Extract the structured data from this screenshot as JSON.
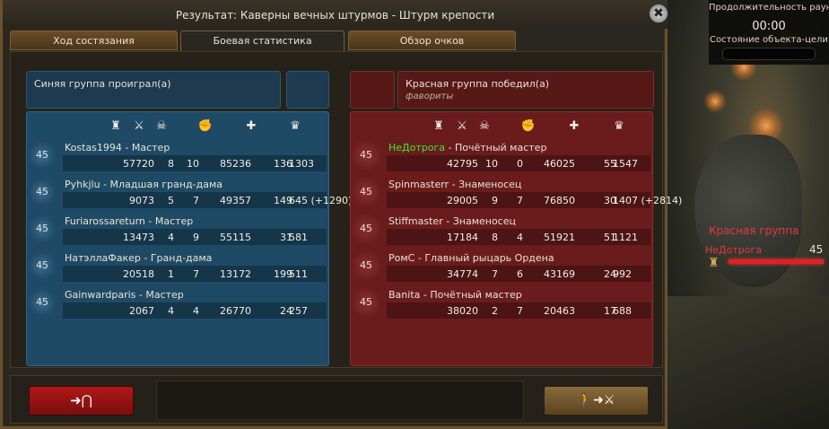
{
  "window": {
    "title": "Результат: Каверны вечных штурмов - Штурм крепости",
    "close_label": "✖"
  },
  "tabs": [
    {
      "label": "Ход состязания"
    },
    {
      "label": "Боевая статистика"
    },
    {
      "label": "Обзор очков"
    }
  ],
  "blue": {
    "result": "Синяя группа проиграл(а)",
    "players": [
      {
        "level": "45",
        "name": "Kostas1994",
        "rank": "Мастер",
        "s1": "57720",
        "s2": "8",
        "s3": "10",
        "s4": "85236",
        "s5": "136",
        "s6": "1303"
      },
      {
        "level": "45",
        "name": "Pyhkjlu",
        "rank": "Младшая гранд-дама",
        "s1": "9073",
        "s2": "5",
        "s3": "7",
        "s4": "49357",
        "s5": "149",
        "s6": "645 (+1290)"
      },
      {
        "level": "45",
        "name": "Furiarossareturn",
        "rank": "Мастер",
        "s1": "13473",
        "s2": "4",
        "s3": "9",
        "s4": "55115",
        "s5": "31",
        "s6": "581"
      },
      {
        "level": "45",
        "name": "НатэллаФакер",
        "rank": "Гранд-дама",
        "s1": "20518",
        "s2": "1",
        "s3": "7",
        "s4": "13172",
        "s5": "199",
        "s6": "511"
      },
      {
        "level": "45",
        "name": "Gainwardparis",
        "rank": "Мастер",
        "s1": "2067",
        "s2": "4",
        "s3": "4",
        "s4": "26770",
        "s5": "24",
        "s6": "257"
      }
    ]
  },
  "red": {
    "result": "Красная группа победил(а)",
    "subtitle": "фавориты",
    "players": [
      {
        "level": "45",
        "name": "НеДотрога",
        "rank": "Почётный мастер",
        "s1": "42795",
        "s2": "10",
        "s3": "0",
        "s4": "46025",
        "s5": "55",
        "s6": "1547",
        "self": true
      },
      {
        "level": "45",
        "name": "Spinmasterr",
        "rank": "Знаменосец",
        "s1": "29005",
        "s2": "9",
        "s3": "7",
        "s4": "76850",
        "s5": "30",
        "s6": "1407 (+2814)"
      },
      {
        "level": "45",
        "name": "Stiffmaster",
        "rank": "Знаменосец",
        "s1": "17184",
        "s2": "8",
        "s3": "4",
        "s4": "51921",
        "s5": "51",
        "s6": "1121"
      },
      {
        "level": "45",
        "name": "PомС",
        "rank": "Главный рыцарь Ордена",
        "s1": "34774",
        "s2": "7",
        "s3": "6",
        "s4": "43169",
        "s5": "24",
        "s6": "992"
      },
      {
        "level": "45",
        "name": "Banita",
        "rank": "Почётный мастер",
        "s1": "38020",
        "s2": "2",
        "s3": "7",
        "s4": "20463",
        "s5": "17",
        "s6": "688"
      }
    ]
  },
  "icons": [
    "rook-icon",
    "crossed-swords-icon",
    "skull-icon",
    "fist-icon",
    "plus-icon",
    "crown-icon"
  ],
  "hud": {
    "duration_label": "Продолжительность раунд",
    "time": "00:00",
    "objective_label": "Состояние объекта-цели",
    "red_group_label": "Красная группа",
    "red_player": "НеДотрога",
    "red_player_level": "45"
  },
  "buttons": {
    "exit_label": "➜⋂",
    "rejoin_label": "🚶➜⚔"
  },
  "colors": {
    "blue_panel": "#1e4a66",
    "red_panel": "#6a1c1c",
    "self_name": "#38e838"
  }
}
